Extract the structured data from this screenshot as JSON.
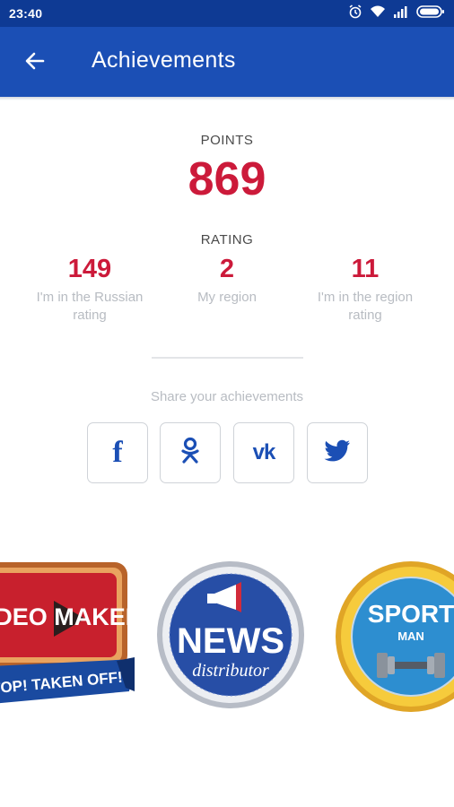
{
  "status_bar": {
    "time": "23:40",
    "icons": [
      "alarm-icon",
      "wifi-icon",
      "signal-icon",
      "battery-icon"
    ]
  },
  "app_bar": {
    "title": "Achievements",
    "back_icon": "arrow-left-icon"
  },
  "points": {
    "label": "POINTS",
    "value": "869"
  },
  "rating": {
    "label": "RATING",
    "items": [
      {
        "value": "149",
        "description_line1": "I'm in the Russian",
        "description_line2": "rating"
      },
      {
        "value": "2",
        "description_line1": "My region",
        "description_line2": ""
      },
      {
        "value": "11",
        "description_line1": "I'm in the region",
        "description_line2": "rating"
      }
    ]
  },
  "share": {
    "label": "Share your achievements",
    "buttons": [
      {
        "name": "facebook-icon",
        "glyph": "f"
      },
      {
        "name": "odnoklassniki-icon",
        "glyph": ""
      },
      {
        "name": "vk-icon",
        "glyph": "vk"
      },
      {
        "name": "twitter-icon",
        "glyph": ""
      }
    ]
  },
  "badges": [
    {
      "title": "VIDEO MAKER",
      "ribbon": "TOP! TAKEN OFF!"
    },
    {
      "title": "NEWS",
      "subtitle": "distributor"
    },
    {
      "title": "SPORT",
      "subtitle": "MAN"
    }
  ],
  "colors": {
    "appbar": "#1b4fb5",
    "statusbar": "#0e3a94",
    "accent_red": "#cc1a3a",
    "muted_text": "#b8bcc2"
  }
}
